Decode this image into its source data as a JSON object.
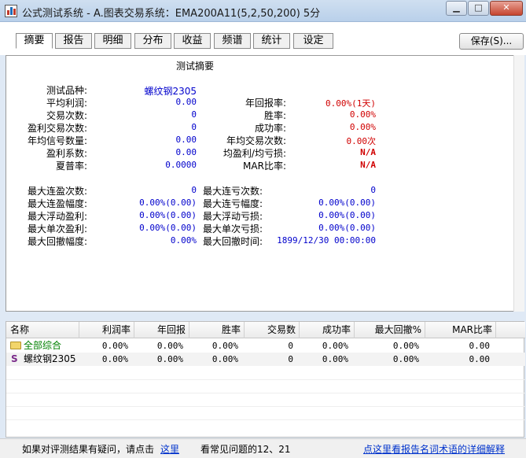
{
  "window": {
    "title": "公式测试系统 - A.图表交易系统：EMA200A11(5,2,50,200) 5分"
  },
  "tabs": [
    {
      "label": "摘要",
      "active": true
    },
    {
      "label": "报告"
    },
    {
      "label": "明细"
    },
    {
      "label": "分布"
    },
    {
      "label": "收益"
    },
    {
      "label": "频谱"
    },
    {
      "label": "统计"
    },
    {
      "label": "设定"
    }
  ],
  "toolbar": {
    "save_label": "保存(S)..."
  },
  "summary": {
    "title": "测试摘要",
    "left": [
      {
        "label": "测试品种:",
        "value": "螺纹钢2305"
      },
      {
        "label": "平均利润:",
        "value": "0.00"
      },
      {
        "label": "交易次数:",
        "value": "0"
      },
      {
        "label": "盈利交易次数:",
        "value": "0"
      },
      {
        "label": "年均信号数量:",
        "value": "0.00"
      },
      {
        "label": "盈利系数:",
        "value": "0.00"
      },
      {
        "label": "夏普率:",
        "value": "0.0000"
      }
    ],
    "right": [
      {
        "label": "年回报率:",
        "value": "0.00%(1天)"
      },
      {
        "label": "胜率:",
        "value": "0.00%"
      },
      {
        "label": "成功率:",
        "value": "0.00%"
      },
      {
        "label": "年均交易次数:",
        "value": "0.00次"
      },
      {
        "label": "均盈利/均亏损:",
        "value": "N/A"
      },
      {
        "label": "MAR比率:",
        "value": "N/A"
      }
    ],
    "left2": [
      {
        "label": "最大连盈次数:",
        "value": "0"
      },
      {
        "label": "最大连盈幅度:",
        "value": "0.00%(0.00)"
      },
      {
        "label": "最大浮动盈利:",
        "value": "0.00%(0.00)"
      },
      {
        "label": "最大单次盈利:",
        "value": "0.00%(0.00)"
      },
      {
        "label": "最大回撤幅度:",
        "value": "0.00%"
      }
    ],
    "right2": [
      {
        "label": "最大连亏次数:",
        "value": "0"
      },
      {
        "label": "最大连亏幅度:",
        "value": "0.00%(0.00)"
      },
      {
        "label": "最大浮动亏损:",
        "value": "0.00%(0.00)"
      },
      {
        "label": "最大单次亏损:",
        "value": "0.00%(0.00)"
      },
      {
        "label": "最大回撤时间:",
        "value": "1899/12/30 00:00:00"
      }
    ]
  },
  "table": {
    "columns": [
      "名称",
      "利润率",
      "年回报",
      "胜率",
      "交易数",
      "成功率",
      "最大回撤%",
      "MAR比率"
    ],
    "rows": [
      {
        "name": "全部综合",
        "icon": "folder-icon",
        "cells": [
          "0.00%",
          "0.00%",
          "0.00%",
          "0",
          "0.00%",
          "0.00%",
          "0.00"
        ]
      },
      {
        "name": "螺纹钢2305",
        "icon": "symbol-s-icon",
        "icon_glyph": "S",
        "cells": [
          "0.00%",
          "0.00%",
          "0.00%",
          "0",
          "0.00%",
          "0.00%",
          "0.00"
        ]
      }
    ]
  },
  "status": {
    "text1": "如果对评测结果有疑问，请点击",
    "link1": "这里",
    "text2": "看常见问题的12、21",
    "link2": "点这里看报告名词术语的详细解释"
  }
}
